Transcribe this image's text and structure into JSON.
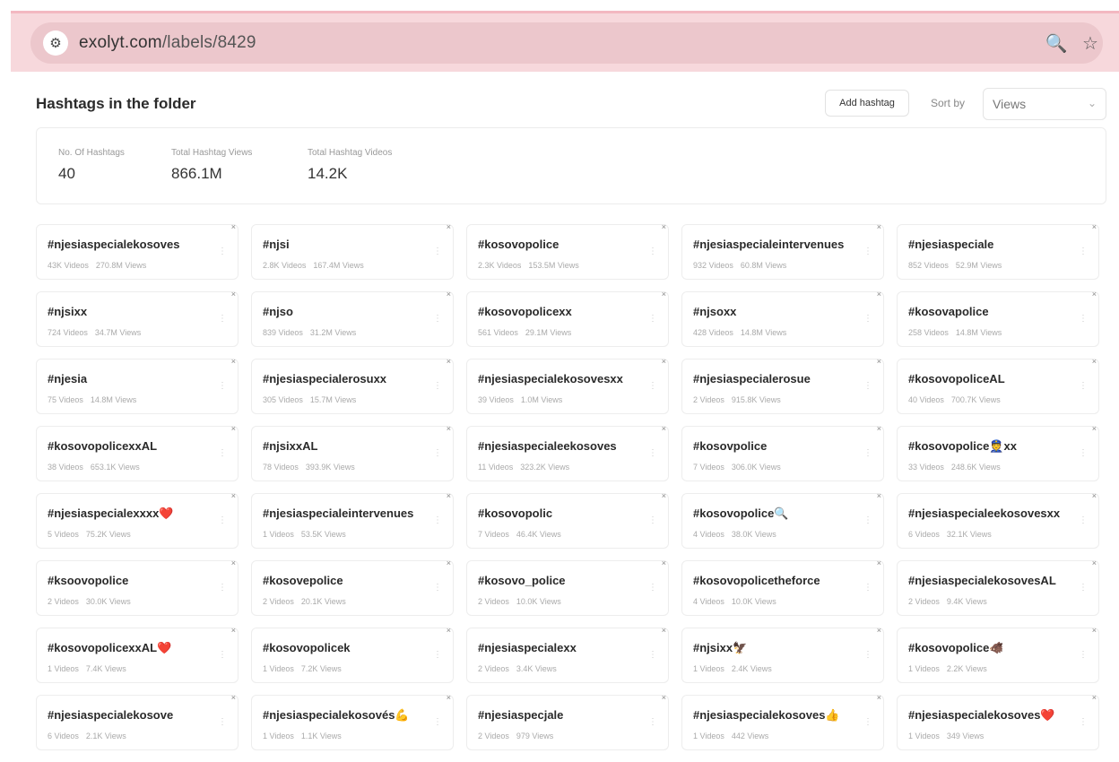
{
  "browser": {
    "url_host": "exolyt.com",
    "url_path": "/labels/8429",
    "site_settings_icon": "tune-icon",
    "zoom_icon": "zoom-icon",
    "bookmark_icon": "star-icon"
  },
  "header": {
    "title": "Hashtags in the folder",
    "add_button_label": "Add hashtag",
    "sort_label": "Sort by",
    "sort_value": "Views"
  },
  "stats": [
    {
      "label": "No. Of Hashtags",
      "value": "40"
    },
    {
      "label": "Total Hashtag Views",
      "value": "866.1M"
    },
    {
      "label": "Total Hashtag Videos",
      "value": "14.2K"
    }
  ],
  "hashtags": [
    {
      "tag": "#njesiaspecialekosoves",
      "videos": "43K Videos",
      "views": "270.8M Views"
    },
    {
      "tag": "#njsi",
      "videos": "2.8K Videos",
      "views": "167.4M Views"
    },
    {
      "tag": "#kosovopolice",
      "videos": "2.3K Videos",
      "views": "153.5M Views"
    },
    {
      "tag": "#njesiaspecialeintervenues",
      "videos": "932 Videos",
      "views": "60.8M Views"
    },
    {
      "tag": "#njesiaspeciale",
      "videos": "852 Videos",
      "views": "52.9M Views"
    },
    {
      "tag": "#njsixx",
      "videos": "724 Videos",
      "views": "34.7M Views"
    },
    {
      "tag": "#njso",
      "videos": "839 Videos",
      "views": "31.2M Views"
    },
    {
      "tag": "#kosovopolicexx",
      "videos": "561 Videos",
      "views": "29.1M Views"
    },
    {
      "tag": "#njsoxx",
      "videos": "428 Videos",
      "views": "14.8M Views"
    },
    {
      "tag": "#kosovapolice",
      "videos": "258 Videos",
      "views": "14.8M Views"
    },
    {
      "tag": "#njesia",
      "videos": "75 Videos",
      "views": "14.8M Views"
    },
    {
      "tag": "#njesiaspecialerosuxx",
      "videos": "305 Videos",
      "views": "15.7M Views"
    },
    {
      "tag": "#njesiaspecialekosovesxx",
      "videos": "39 Videos",
      "views": "1.0M Views"
    },
    {
      "tag": "#njesiaspecialerosue",
      "videos": "2 Videos",
      "views": "915.8K Views"
    },
    {
      "tag": "#kosovopoliceAL",
      "videos": "40 Videos",
      "views": "700.7K Views"
    },
    {
      "tag": "#kosovopolicexxAL",
      "videos": "38 Videos",
      "views": "653.1K Views"
    },
    {
      "tag": "#njsixxAL",
      "videos": "78 Videos",
      "views": "393.9K Views"
    },
    {
      "tag": "#njesiaspecialeekosoves",
      "videos": "11 Videos",
      "views": "323.2K Views"
    },
    {
      "tag": "#kosovpolice",
      "videos": "7 Videos",
      "views": "306.0K Views"
    },
    {
      "tag": "#kosovopolice👮xx",
      "videos": "33 Videos",
      "views": "248.6K Views"
    },
    {
      "tag": "#njesiaspecialexxxx❤️",
      "videos": "5 Videos",
      "views": "75.2K Views"
    },
    {
      "tag": "#njesiaspecialeintervenues",
      "videos": "1 Videos",
      "views": "53.5K Views"
    },
    {
      "tag": "#kosovopolic",
      "videos": "7 Videos",
      "views": "46.4K Views"
    },
    {
      "tag": "#kosovopolice🔍",
      "videos": "4 Videos",
      "views": "38.0K Views"
    },
    {
      "tag": "#njesiaspecialeekosovesxx",
      "videos": "6 Videos",
      "views": "32.1K Views"
    },
    {
      "tag": "#ksoovopolice",
      "videos": "2 Videos",
      "views": "30.0K Views"
    },
    {
      "tag": "#kosovepolice",
      "videos": "2 Videos",
      "views": "20.1K Views"
    },
    {
      "tag": "#kosovo_police",
      "videos": "2 Videos",
      "views": "10.0K Views"
    },
    {
      "tag": "#kosovopolicetheforce",
      "videos": "4 Videos",
      "views": "10.0K Views"
    },
    {
      "tag": "#njesiaspecialekosovesAL",
      "videos": "2 Videos",
      "views": "9.4K Views"
    },
    {
      "tag": "#kosovopolicexxAL❤️",
      "videos": "1 Videos",
      "views": "7.4K Views"
    },
    {
      "tag": "#kosovopolicek",
      "videos": "1 Videos",
      "views": "7.2K Views"
    },
    {
      "tag": "#njesiaspecialexx",
      "videos": "2 Videos",
      "views": "3.4K Views"
    },
    {
      "tag": "#njsixx🦅",
      "videos": "1 Videos",
      "views": "2.4K Views"
    },
    {
      "tag": "#kosovopolice🐗",
      "videos": "1 Videos",
      "views": "2.2K Views"
    },
    {
      "tag": "#njesiaspecialekosove",
      "videos": "6 Videos",
      "views": "2.1K Views"
    },
    {
      "tag": "#njesiaspecialekosovés💪",
      "videos": "1 Videos",
      "views": "1.1K Views"
    },
    {
      "tag": "#njesiaspecjale",
      "videos": "2 Videos",
      "views": "979 Views"
    },
    {
      "tag": "#njesiaspecialekosoves👍",
      "videos": "1 Videos",
      "views": "442 Views"
    },
    {
      "tag": "#njesiaspecialekosoves❤️",
      "videos": "1 Videos",
      "views": "349 Views"
    }
  ],
  "card_remove_icon": "close-icon",
  "card_menu_icon": "more-icon"
}
